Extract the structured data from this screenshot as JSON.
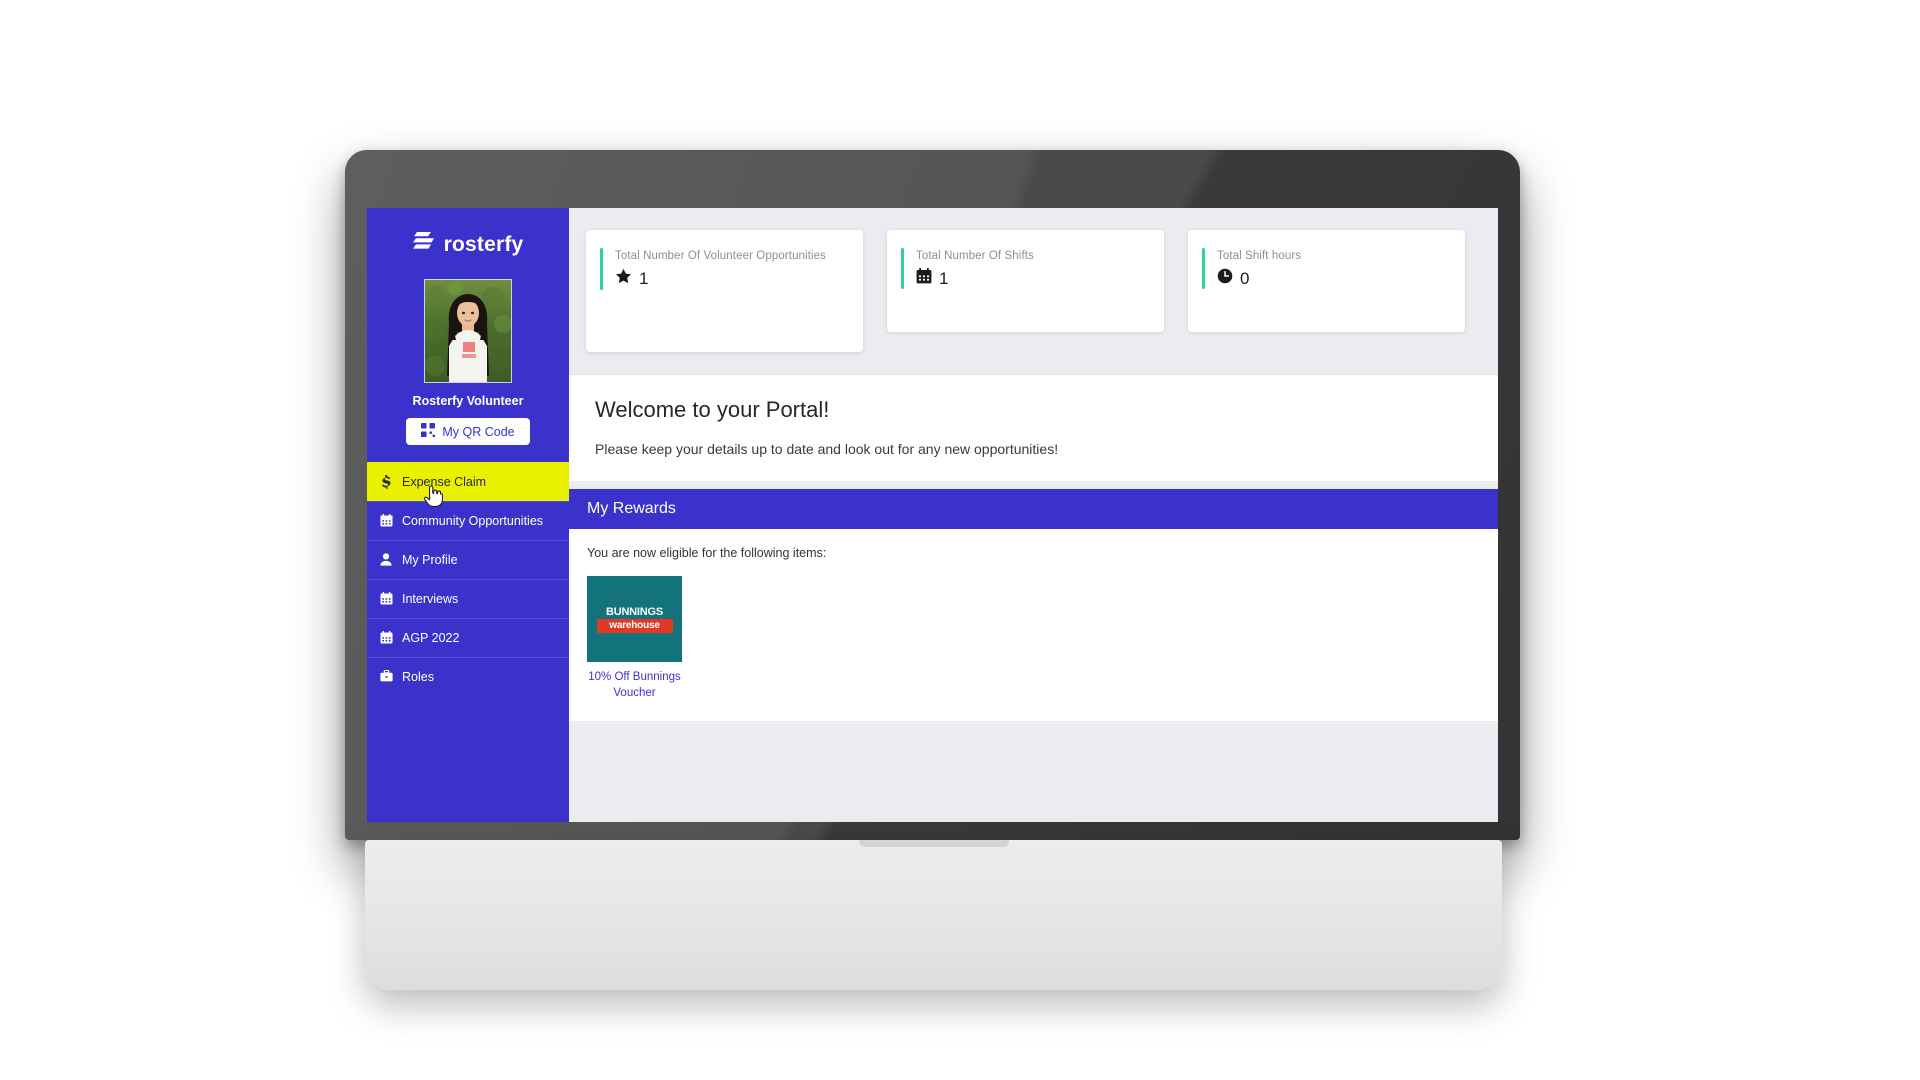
{
  "brand": {
    "name": "rosterfy",
    "logo_icon": "rosterfy-bars-logo"
  },
  "colors": {
    "sidebar_blue": "#3b32cc",
    "accent_yellow": "#e9f000",
    "stat_green": "#2ed29b",
    "page_background": "#ebecf0",
    "bunnings_teal": "#12737a",
    "bunnings_red": "#e03a24"
  },
  "sidebar": {
    "profile_name": "Rosterfy Volunteer",
    "avatar_alt": "volunteer-profile-photo",
    "qr_button": {
      "label": "My QR Code",
      "icon": "qr-code-icon"
    },
    "items": [
      {
        "label": "Expense Claim",
        "icon": "dollar-icon",
        "active": true
      },
      {
        "label": "Community Opportunities",
        "icon": "calendar-icon",
        "active": false
      },
      {
        "label": "My Profile",
        "icon": "person-icon",
        "active": false
      },
      {
        "label": "Interviews",
        "icon": "calendar-icon",
        "active": false
      },
      {
        "label": "AGP 2022",
        "icon": "calendar-icon",
        "active": false
      },
      {
        "label": "Roles",
        "icon": "briefcase-icon",
        "active": false
      }
    ]
  },
  "stats": [
    {
      "title": "Total Number Of Volunteer Opportunities",
      "value": "1",
      "icon": "star-icon"
    },
    {
      "title": "Total Number Of Shifts",
      "value": "1",
      "icon": "calendar-icon"
    },
    {
      "title": "Total Shift hours",
      "value": "0",
      "icon": "clock-icon"
    }
  ],
  "welcome": {
    "title": "Welcome to your Portal!",
    "subtitle": "Please keep your details up to date and look out for any new opportunities!"
  },
  "rewards": {
    "heading": "My Rewards",
    "note": "You are now eligible for the following items:",
    "items": [
      {
        "label": "10% Off Bunnings Voucher",
        "logo_top": "BUNNINGS",
        "logo_bottom": "warehouse"
      }
    ]
  }
}
